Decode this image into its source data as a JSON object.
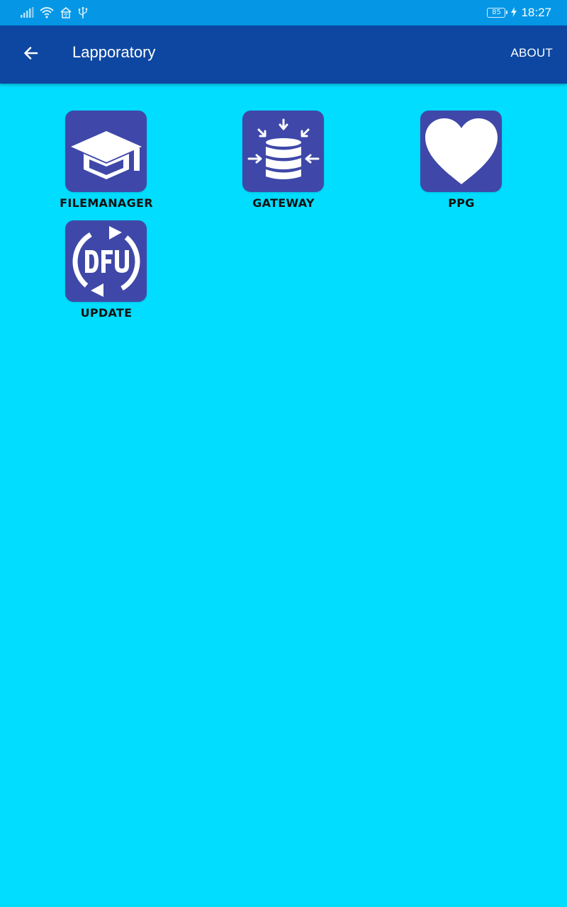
{
  "status_bar": {
    "battery_level": "85",
    "time": "18:27",
    "icons": [
      "signal-icon",
      "wifi-icon",
      "hotspot-icon",
      "usb-icon",
      "battery-icon",
      "charging-icon"
    ]
  },
  "app_bar": {
    "title": "Lapporatory",
    "action_label": "ABOUT",
    "background": "#0D47A1"
  },
  "tiles": [
    {
      "label": "FILEMANAGER",
      "icon": "graduation-cap-icon"
    },
    {
      "label": "GATEWAY",
      "icon": "database-gateway-icon"
    },
    {
      "label": "PPG",
      "icon": "heart-icon"
    },
    {
      "label": "UPDATE",
      "icon": "dfu-update-icon"
    }
  ],
  "colors": {
    "status_bar": "#0597E6",
    "background": "#00DDFF",
    "tile": "#3F48A8"
  }
}
